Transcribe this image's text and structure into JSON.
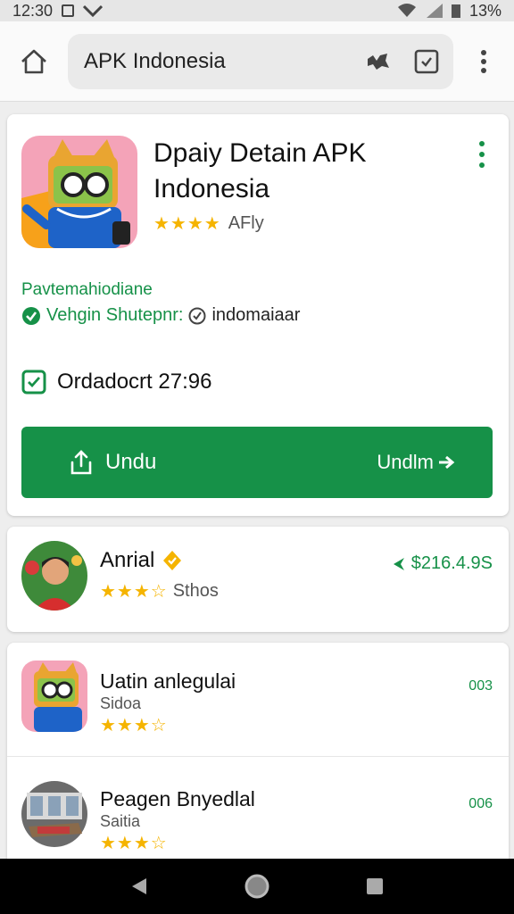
{
  "status_bar": {
    "time": "12:30",
    "battery": "13%"
  },
  "url_bar": {
    "url": "APK Indonesia"
  },
  "app": {
    "title": "Dpaiy Detain APK Indonesia",
    "stars": "★★★★",
    "rating_text": "AFly",
    "category": "Pavtemahiodiane",
    "verify_label": "Vehgin Shutepnr:",
    "domain": "indomaiaar",
    "date": "Ordadocrt 27:96",
    "download_label": "Undu",
    "download_right_label": "Undlm"
  },
  "developer": {
    "name": "Anrial",
    "stars": "★★★☆",
    "rating_label": "Sthos",
    "price": "$216.4.9S"
  },
  "list": [
    {
      "title": "Uatin anlegulai",
      "sub": "Sidoa",
      "stars": "★★★☆",
      "size": "003"
    },
    {
      "title": "Peagen Bnyedlal",
      "sub": "Saitia",
      "stars": "★★★☆",
      "size": "006"
    }
  ],
  "colors": {
    "accent": "#169148",
    "star": "#f5b400",
    "nav": "#000000"
  }
}
